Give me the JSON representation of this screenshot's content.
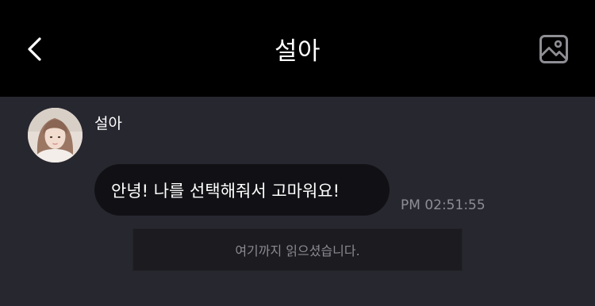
{
  "header": {
    "title": "설아",
    "back_icon": "chevron-left-icon",
    "gallery_icon": "image-icon"
  },
  "chat": {
    "messages": [
      {
        "sender": "설아",
        "avatar_icon": "avatar-photo",
        "text": "안녕! 나를 선택해줘서 고마워요!",
        "time": "PM 02:51:55"
      }
    ],
    "read_marker": "여기까지 읽으셨습니다."
  },
  "colors": {
    "header_bg": "#000000",
    "chat_bg": "#272730",
    "bubble_bg": "#111115",
    "marker_bg": "#1b1b20",
    "text_primary": "#ffffff",
    "text_muted": "#8d8d94"
  }
}
